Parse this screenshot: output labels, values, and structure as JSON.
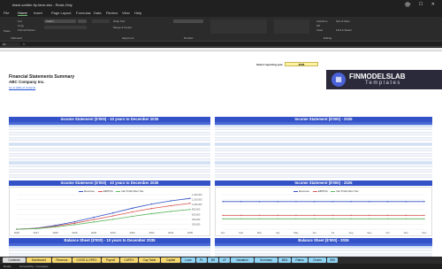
{
  "window": {
    "title": "black-soldier-fly-farm.xlsx - Read-Only"
  },
  "menu": [
    "File",
    "Home",
    "Insert",
    "Page Layout",
    "Formulas",
    "Data",
    "Review",
    "View",
    "Help"
  ],
  "ribbon": {
    "paste": "Paste",
    "cut": "Cut",
    "copy": "Copy",
    "format_painter": "Format Painter",
    "font": "Calibri",
    "wrap": "Wrap Text",
    "merge": "Merge & Center",
    "autosum": "AutoSum",
    "fill": "Fill",
    "clear": "Clear",
    "clipboard": "Clipboard",
    "alignment": "Alignment",
    "number": "Number",
    "editing": "Editing",
    "sort_filter": "Sort & Filter",
    "find_select": "Find & Select"
  },
  "formula_bar": {
    "name_box": "A1",
    "fx": "fx"
  },
  "sheet": {
    "title": "Financial Statements Summary",
    "company": "ABC Company Inc.",
    "link": "Go to table of contents",
    "select_year_label": "Select reporting year",
    "select_year_value": "2026"
  },
  "logo": {
    "line1": "FINMODELSLAB",
    "line2": "Templates"
  },
  "sections": {
    "is_10y": "Income Statement ($'000) - 10 years to December 2035",
    "is_year": "Income Statement ($'000) - 2026",
    "bs_10y": "Balance Sheet ($'000) - 10 years to December 2035",
    "bs_year": "Balance Sheet ($'000) - 2026"
  },
  "chart_legend": {
    "revenue": "Revenue",
    "ebitda": "EBITDA",
    "npat": "Net Profit After Tax"
  },
  "colors": {
    "header": "#3452c7",
    "revenue": "#2f4fc4",
    "ebitda": "#d9534f",
    "npat": "#5cb85c"
  },
  "chart_data": [
    {
      "type": "line",
      "title": "Income Statement ($'000) - 10 years to December 2035",
      "x": [
        "2026",
        "2027",
        "2028",
        "2029",
        "2030",
        "2031",
        "2032",
        "2033",
        "2034",
        "2035"
      ],
      "series": [
        {
          "name": "Revenue",
          "values": [
            0,
            40000,
            150000,
            300000,
            480000,
            660000,
            850000,
            1020000,
            1150000,
            1250000
          ]
        },
        {
          "name": "EBITDA",
          "values": [
            0,
            30000,
            120000,
            240000,
            390000,
            540000,
            700000,
            840000,
            950000,
            1050000
          ]
        },
        {
          "name": "Net Profit After Tax",
          "values": [
            0,
            20000,
            90000,
            180000,
            290000,
            400000,
            520000,
            630000,
            720000,
            800000
          ]
        }
      ],
      "ylim": [
        0,
        1400000
      ],
      "yticks": [
        "-",
        "200,000",
        "400,000",
        "600,000",
        "800,000",
        "1,000,000",
        "1,200,000",
        "1,400,000"
      ]
    },
    {
      "type": "line",
      "title": "Income Statement ($'000) - 2026",
      "x": [
        "Jan",
        "Feb",
        "Mar",
        "Apr",
        "May",
        "Jun",
        "Jul",
        "Aug",
        "Sep",
        "Oct",
        "Nov",
        "Dec"
      ],
      "series": [
        {
          "name": "Revenue",
          "values": [
            6000,
            6000,
            6000,
            6000,
            6000,
            6000,
            6000,
            6000,
            6000,
            6000,
            6000,
            6000
          ]
        },
        {
          "name": "EBITDA",
          "values": [
            -2000,
            -2000,
            -2000,
            -2000,
            -2000,
            -2000,
            -2000,
            -2000,
            -2000,
            -2000,
            -2000,
            -2000
          ]
        },
        {
          "name": "Net Profit After Tax",
          "values": [
            -4000,
            -4000,
            -4000,
            -4000,
            -4000,
            -4000,
            -4000,
            -4000,
            -4000,
            -4000,
            -4000,
            -4000
          ]
        }
      ],
      "ylim": [
        -10000,
        10000
      ]
    }
  ],
  "tabs": [
    {
      "label": "Contents",
      "color": "#dcdcdc"
    },
    {
      "label": "Dashboard",
      "color": "#f5d76e"
    },
    {
      "label": "Revenue",
      "color": "#f5d76e"
    },
    {
      "label": "COGS & OPEX",
      "color": "#f5d76e"
    },
    {
      "label": "Payroll",
      "color": "#f5d76e"
    },
    {
      "label": "CAPEX",
      "color": "#f5d76e"
    },
    {
      "label": "Cap Table",
      "color": "#f5d76e"
    },
    {
      "label": "Capital",
      "color": "#f5d76e"
    },
    {
      "label": "Loan",
      "color": "#8fd3f4"
    },
    {
      "label": "PL",
      "color": "#8fd3f4"
    },
    {
      "label": "BS",
      "color": "#8fd3f4"
    },
    {
      "label": "CF",
      "color": "#8fd3f4"
    },
    {
      "label": "Valuation",
      "color": "#8fd3f4"
    },
    {
      "label": "Summary",
      "color": "#8fd3f4"
    },
    {
      "label": "BEA",
      "color": "#8fd3f4"
    },
    {
      "label": "Ratios",
      "color": "#8fd3f4"
    },
    {
      "label": "Charts",
      "color": "#8fd3f4"
    },
    {
      "label": "SIM",
      "color": "#8fd3f4"
    }
  ],
  "status": {
    "ready": "Ready",
    "accessibility": "Accessibility: Investigate"
  }
}
